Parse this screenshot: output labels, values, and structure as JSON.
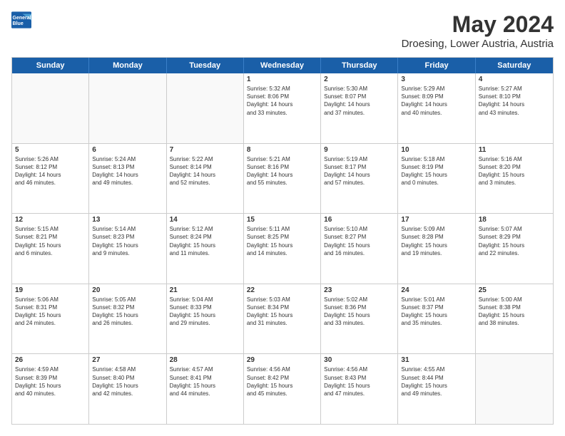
{
  "header": {
    "logo_line1": "General",
    "logo_line2": "Blue",
    "main_title": "May 2024",
    "subtitle": "Droesing, Lower Austria, Austria"
  },
  "day_names": [
    "Sunday",
    "Monday",
    "Tuesday",
    "Wednesday",
    "Thursday",
    "Friday",
    "Saturday"
  ],
  "weeks": [
    [
      {
        "day": "",
        "info": ""
      },
      {
        "day": "",
        "info": ""
      },
      {
        "day": "",
        "info": ""
      },
      {
        "day": "1",
        "info": "Sunrise: 5:32 AM\nSunset: 8:06 PM\nDaylight: 14 hours\nand 33 minutes."
      },
      {
        "day": "2",
        "info": "Sunrise: 5:30 AM\nSunset: 8:07 PM\nDaylight: 14 hours\nand 37 minutes."
      },
      {
        "day": "3",
        "info": "Sunrise: 5:29 AM\nSunset: 8:09 PM\nDaylight: 14 hours\nand 40 minutes."
      },
      {
        "day": "4",
        "info": "Sunrise: 5:27 AM\nSunset: 8:10 PM\nDaylight: 14 hours\nand 43 minutes."
      }
    ],
    [
      {
        "day": "5",
        "info": "Sunrise: 5:26 AM\nSunset: 8:12 PM\nDaylight: 14 hours\nand 46 minutes."
      },
      {
        "day": "6",
        "info": "Sunrise: 5:24 AM\nSunset: 8:13 PM\nDaylight: 14 hours\nand 49 minutes."
      },
      {
        "day": "7",
        "info": "Sunrise: 5:22 AM\nSunset: 8:14 PM\nDaylight: 14 hours\nand 52 minutes."
      },
      {
        "day": "8",
        "info": "Sunrise: 5:21 AM\nSunset: 8:16 PM\nDaylight: 14 hours\nand 55 minutes."
      },
      {
        "day": "9",
        "info": "Sunrise: 5:19 AM\nSunset: 8:17 PM\nDaylight: 14 hours\nand 57 minutes."
      },
      {
        "day": "10",
        "info": "Sunrise: 5:18 AM\nSunset: 8:19 PM\nDaylight: 15 hours\nand 0 minutes."
      },
      {
        "day": "11",
        "info": "Sunrise: 5:16 AM\nSunset: 8:20 PM\nDaylight: 15 hours\nand 3 minutes."
      }
    ],
    [
      {
        "day": "12",
        "info": "Sunrise: 5:15 AM\nSunset: 8:21 PM\nDaylight: 15 hours\nand 6 minutes."
      },
      {
        "day": "13",
        "info": "Sunrise: 5:14 AM\nSunset: 8:23 PM\nDaylight: 15 hours\nand 9 minutes."
      },
      {
        "day": "14",
        "info": "Sunrise: 5:12 AM\nSunset: 8:24 PM\nDaylight: 15 hours\nand 11 minutes."
      },
      {
        "day": "15",
        "info": "Sunrise: 5:11 AM\nSunset: 8:25 PM\nDaylight: 15 hours\nand 14 minutes."
      },
      {
        "day": "16",
        "info": "Sunrise: 5:10 AM\nSunset: 8:27 PM\nDaylight: 15 hours\nand 16 minutes."
      },
      {
        "day": "17",
        "info": "Sunrise: 5:09 AM\nSunset: 8:28 PM\nDaylight: 15 hours\nand 19 minutes."
      },
      {
        "day": "18",
        "info": "Sunrise: 5:07 AM\nSunset: 8:29 PM\nDaylight: 15 hours\nand 22 minutes."
      }
    ],
    [
      {
        "day": "19",
        "info": "Sunrise: 5:06 AM\nSunset: 8:31 PM\nDaylight: 15 hours\nand 24 minutes."
      },
      {
        "day": "20",
        "info": "Sunrise: 5:05 AM\nSunset: 8:32 PM\nDaylight: 15 hours\nand 26 minutes."
      },
      {
        "day": "21",
        "info": "Sunrise: 5:04 AM\nSunset: 8:33 PM\nDaylight: 15 hours\nand 29 minutes."
      },
      {
        "day": "22",
        "info": "Sunrise: 5:03 AM\nSunset: 8:34 PM\nDaylight: 15 hours\nand 31 minutes."
      },
      {
        "day": "23",
        "info": "Sunrise: 5:02 AM\nSunset: 8:36 PM\nDaylight: 15 hours\nand 33 minutes."
      },
      {
        "day": "24",
        "info": "Sunrise: 5:01 AM\nSunset: 8:37 PM\nDaylight: 15 hours\nand 35 minutes."
      },
      {
        "day": "25",
        "info": "Sunrise: 5:00 AM\nSunset: 8:38 PM\nDaylight: 15 hours\nand 38 minutes."
      }
    ],
    [
      {
        "day": "26",
        "info": "Sunrise: 4:59 AM\nSunset: 8:39 PM\nDaylight: 15 hours\nand 40 minutes."
      },
      {
        "day": "27",
        "info": "Sunrise: 4:58 AM\nSunset: 8:40 PM\nDaylight: 15 hours\nand 42 minutes."
      },
      {
        "day": "28",
        "info": "Sunrise: 4:57 AM\nSunset: 8:41 PM\nDaylight: 15 hours\nand 44 minutes."
      },
      {
        "day": "29",
        "info": "Sunrise: 4:56 AM\nSunset: 8:42 PM\nDaylight: 15 hours\nand 45 minutes."
      },
      {
        "day": "30",
        "info": "Sunrise: 4:56 AM\nSunset: 8:43 PM\nDaylight: 15 hours\nand 47 minutes."
      },
      {
        "day": "31",
        "info": "Sunrise: 4:55 AM\nSunset: 8:44 PM\nDaylight: 15 hours\nand 49 minutes."
      },
      {
        "day": "",
        "info": ""
      }
    ]
  ],
  "colors": {
    "header_bg": "#1a5fa8",
    "header_text": "#ffffff",
    "border": "#cccccc",
    "empty_bg": "#f9f9f9"
  }
}
